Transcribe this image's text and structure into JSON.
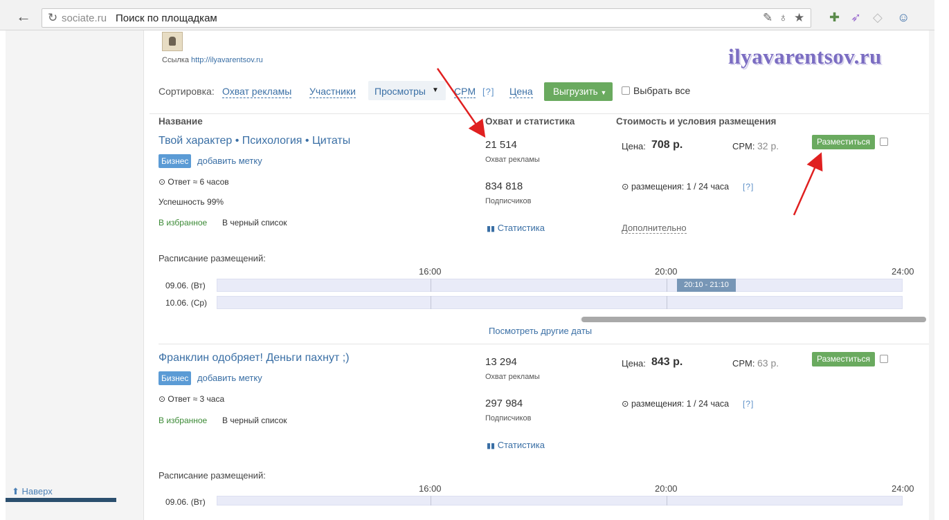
{
  "browser": {
    "url_domain": "sociate.ru",
    "url_page": "Поиск по площадкам"
  },
  "header": {
    "logo_caption_prefix": "Ссылка",
    "logo_link": "http://ilyavarentsov.ru",
    "watermark": "ilyavarentsov.ru"
  },
  "sort": {
    "label": "Сортировка:",
    "options": [
      "Охват рекламы",
      "Участники",
      "Просмотры",
      "CPM"
    ],
    "help": "[?]",
    "price": "Цена",
    "export_label": "Выгрузить",
    "select_all": "Выбрать все"
  },
  "columns": {
    "name": "Название",
    "reach": "Охват и статистика",
    "cost": "Стоимость и условия размещения"
  },
  "listings": [
    {
      "title": "Твой характер • Психология • Цитаты",
      "badge": "Бизнес",
      "add_tag": "добавить метку",
      "response_prefix": "Ответ ≈",
      "response_value": "6 часов",
      "success_label": "Успешность",
      "success_value": "99%",
      "favorites": "В избранное",
      "blacklist": "В черный список",
      "reach_value": "21 514",
      "reach_label": "Охват рекламы",
      "subs_value": "834 818",
      "subs_label": "Подписчиков",
      "stats_link": "Статистика",
      "price_label": "Цена:",
      "price_value": "708 р.",
      "cpm_label": "CPM:",
      "cpm_value": "32 р.",
      "place_label": "Разместиться",
      "placements_label": "размещения:",
      "placements_value": "1 / 24 часа",
      "placements_help": "[?]",
      "more": "Дополнительно",
      "schedule_title": "Расписание размещений:",
      "schedule_hours": [
        "16:00",
        "20:00",
        "24:00"
      ],
      "schedule_days": [
        "09.06. (Вт)",
        "10.06. (Ср)"
      ],
      "slot": "20:10 - 21:10",
      "other_dates": "Посмотреть другие даты"
    },
    {
      "title": "Франклин одобряет! Деньги пахнут ;)",
      "badge": "Бизнес",
      "add_tag": "добавить метку",
      "response_prefix": "Ответ ≈",
      "response_value": "3 часа",
      "favorites": "В избранное",
      "blacklist": "В черный список",
      "reach_value": "13 294",
      "reach_label": "Охват рекламы",
      "subs_value": "297 984",
      "subs_label": "Подписчиков",
      "stats_link": "Статистика",
      "price_label": "Цена:",
      "price_value": "843 р.",
      "cpm_label": "CPM:",
      "cpm_value": "63 р.",
      "place_label": "Разместиться",
      "placements_label": "размещения:",
      "placements_value": "1 / 24 часа",
      "placements_help": "[?]",
      "schedule_title": "Расписание размещений:",
      "schedule_hours": [
        "16:00",
        "20:00",
        "24:00"
      ],
      "schedule_days": [
        "09.06. (Вт)"
      ]
    }
  ],
  "sidebar": {
    "to_top": "Наверх"
  },
  "colors": {
    "link": "#3a6fa5",
    "accent_green": "#6aaa5f",
    "badge_blue": "#5b9bd5",
    "annotation_arrow": "#e02020"
  }
}
